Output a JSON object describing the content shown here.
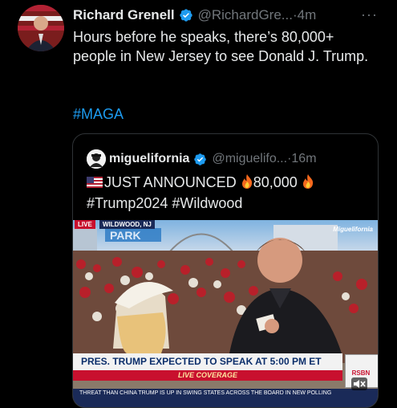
{
  "tweet": {
    "author_name": "Richard Grenell",
    "handle": "@RichardGre...",
    "separator": "·",
    "time": "4m",
    "text": "Hours before he speaks, there’s 80,000+ people in New Jersey to see Donald J. Trump.",
    "hashtag": "#MAGA",
    "more_label": "···"
  },
  "quote": {
    "author_name": "miguelifornia",
    "handle": "@miguelifo...",
    "separator": "·",
    "time": "16m",
    "line1_a": "JUST ANNOUNCED",
    "line1_b": "80,000",
    "line2": "#Trump2024 #Wildwood"
  },
  "video": {
    "live_tag": "LIVE",
    "location_tag": "WILDWOOD, NJ",
    "sign_text": "PARK",
    "brand_watermark": "Miguelifornia",
    "lower_third": "PRES. TRUMP EXPECTED TO SPEAK AT 5:00 PM ET",
    "live_coverage": "LIVE COVERAGE",
    "network_logo": "RSBN",
    "ticker": "THREAT THAN CHINA    TRUMP IS UP IN SWING STATES ACROSS THE BOARD IN NEW POLLING"
  },
  "colors": {
    "link_blue": "#1d9bf0",
    "muted": "#71767b",
    "verified_blue": "#1d9bf0",
    "news_red": "#c8102e",
    "news_navy": "#1a2a58"
  }
}
